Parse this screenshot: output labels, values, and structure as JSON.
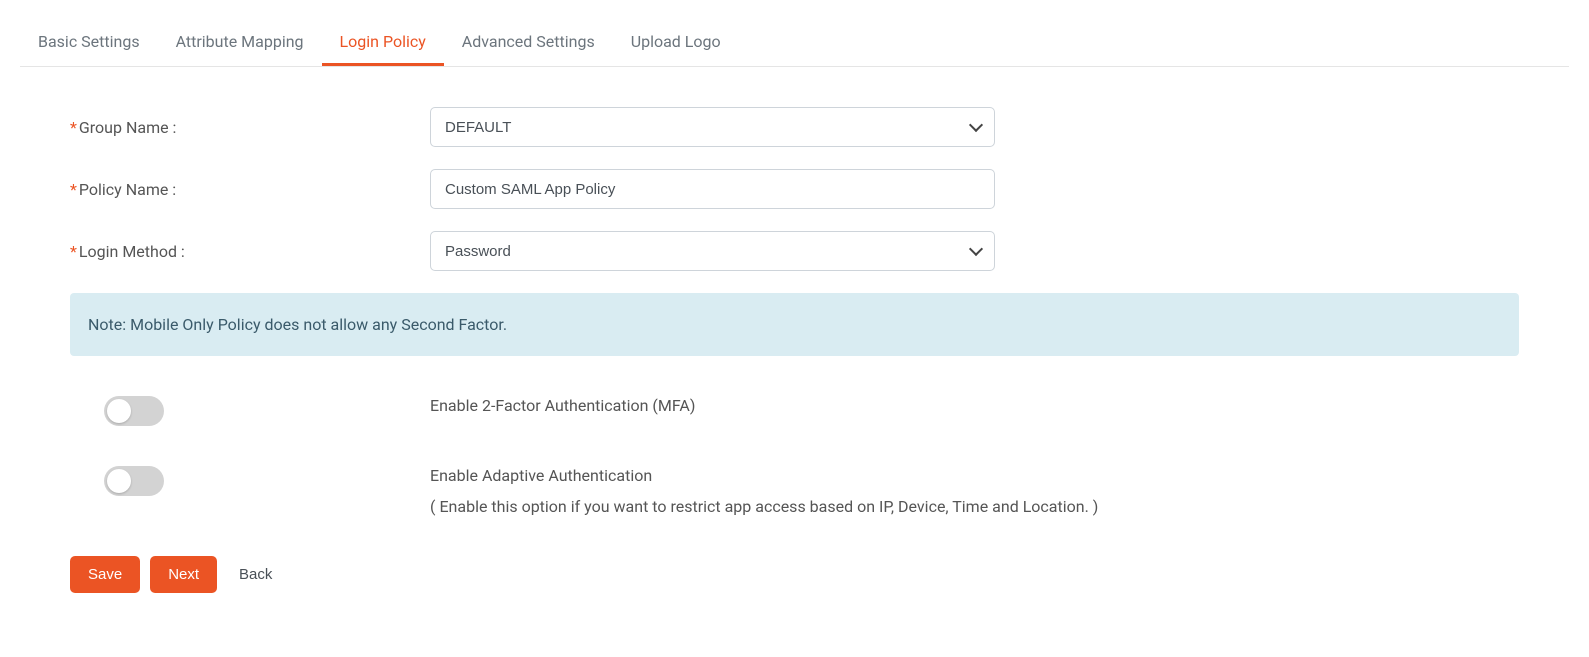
{
  "tabs": [
    {
      "label": "Basic Settings",
      "active": false
    },
    {
      "label": "Attribute Mapping",
      "active": false
    },
    {
      "label": "Login Policy",
      "active": true
    },
    {
      "label": "Advanced Settings",
      "active": false
    },
    {
      "label": "Upload Logo",
      "active": false
    }
  ],
  "form": {
    "group_name": {
      "label": "Group Name :",
      "value": "DEFAULT"
    },
    "policy_name": {
      "label": "Policy Name :",
      "value": "Custom SAML App Policy"
    },
    "login_method": {
      "label": "Login Method :",
      "value": "Password"
    }
  },
  "note": "Note: Mobile Only Policy does not allow any Second Factor.",
  "toggles": {
    "mfa": {
      "label": "Enable 2-Factor Authentication (MFA)",
      "on": false
    },
    "adaptive": {
      "label": "Enable Adaptive Authentication",
      "desc": "( Enable this option if you want to restrict app access based on IP, Device, Time and Location. )",
      "on": false
    }
  },
  "actions": {
    "save": "Save",
    "next": "Next",
    "back": "Back"
  }
}
